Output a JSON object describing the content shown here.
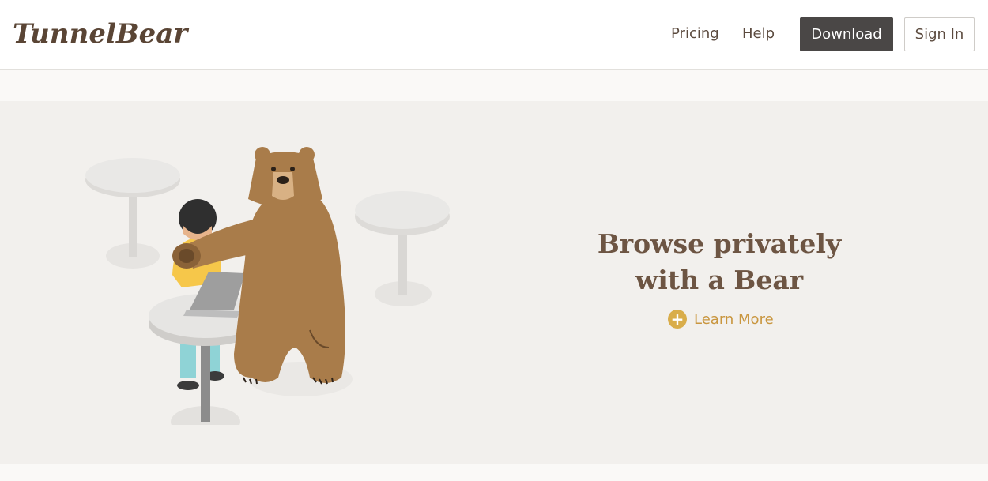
{
  "brand": {
    "name": "TunnelBear"
  },
  "nav": {
    "links": [
      "Pricing",
      "Help"
    ],
    "download_label": "Download",
    "signin_label": "Sign In"
  },
  "hero": {
    "headline_line1": "Browse privately",
    "headline_line2": "with a Bear",
    "learn_more_label": "Learn More",
    "learn_more_icon": "plus-circle-icon"
  },
  "colors": {
    "accent": "#d9ad4a",
    "text_brown": "#6d5543",
    "download_button": "#4a4746",
    "hero_background": "#f2f0ed",
    "bear": "#a97c4a"
  }
}
